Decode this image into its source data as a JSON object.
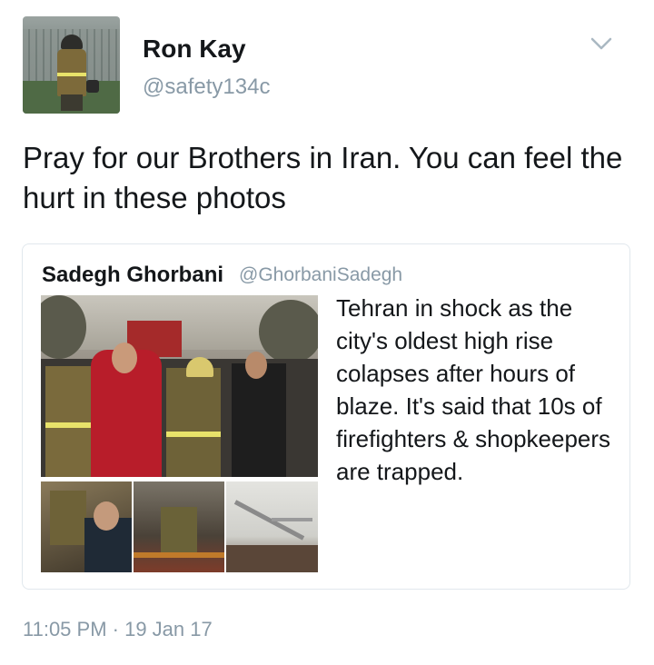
{
  "author": {
    "name": "Ron Kay",
    "handle": "@safety134c",
    "avatar_icon": "firefighter-avatar"
  },
  "menu": {
    "icon": "chevron-down-icon"
  },
  "tweet": {
    "text": "Pray for our Brothers in Iran. You can feel the hurt in these photos"
  },
  "quoted_tweet": {
    "name": "Sadegh Ghorbani",
    "handle": "@GhorbaniSadegh",
    "text": "Tehran in shock as the city's oldest high rise colapses after hours of blaze. It's said that 10s of firefighters & shopkeepers are trapped."
  },
  "timestamp": "11:05 PM · 19 Jan 17",
  "colors": {
    "secondary_text": "#8899a6",
    "primary_text": "#14171a",
    "border": "#e1e8ed"
  }
}
